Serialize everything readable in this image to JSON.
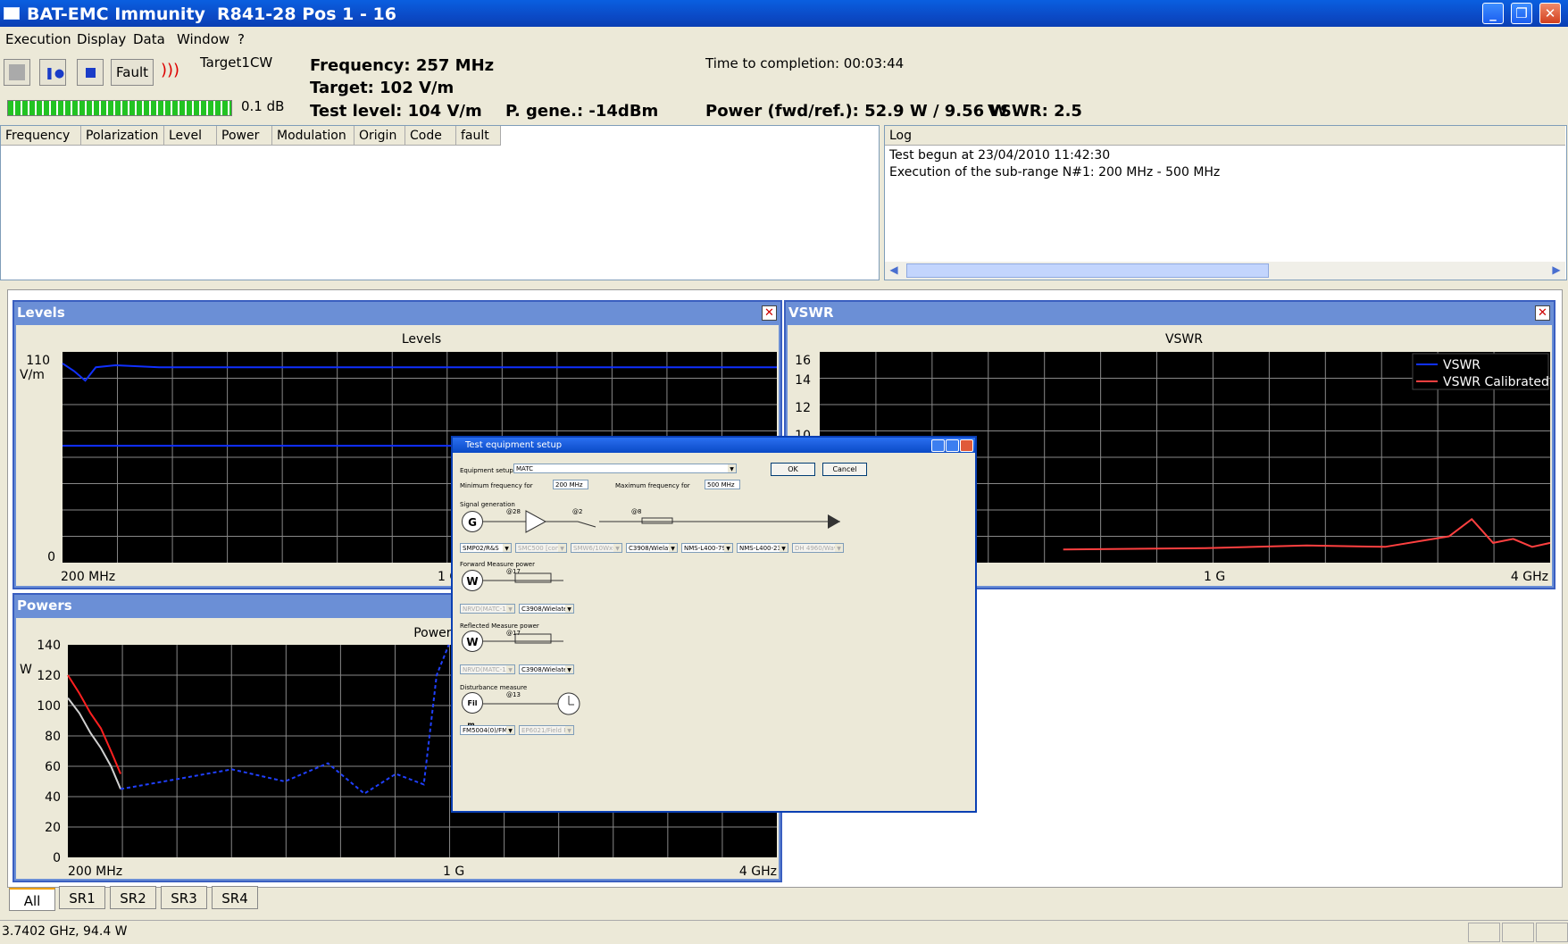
{
  "window": {
    "app_name": "BAT-EMC  Immunity",
    "document": "R841-28 Pos 1 - 16"
  },
  "menu": [
    "Execution",
    "Display",
    "Data",
    "Window",
    "?"
  ],
  "toolbar": {
    "fault_label": "Fault",
    "target_name": "Target1CW",
    "progress_fraction": 1.0,
    "attenuation": "0.1 dB"
  },
  "status": {
    "frequency": "Frequency: 257 MHz",
    "target": "Target: 102 V/m",
    "test_level": "Test level: 104 V/m",
    "p_gene": "P. gene.: -14dBm",
    "time_to_completion": "Time to completion: 00:03:44",
    "power": "Power (fwd/ref.): 52.9 W / 9.56 W",
    "vswr": "VSWR: 2.5"
  },
  "fault_table": {
    "columns": [
      "Frequency",
      "Polarization",
      "Level",
      "Power",
      "Modulation",
      "Origin",
      "Code",
      "fault"
    ],
    "rows": []
  },
  "log": {
    "title": "Log",
    "lines": [
      "Test begun at 23/04/2010 11:42:30",
      "Execution of the sub-range N#1: 200 MHz - 500 MHz"
    ]
  },
  "panels": {
    "levels": {
      "window_title": "Levels",
      "chart_title": "Levels",
      "y_top": "110",
      "y_unit": "V/m",
      "y_bottom": "0",
      "x_ticks": [
        "200 MHz",
        "1 G"
      ]
    },
    "vswr": {
      "window_title": "VSWR",
      "chart_title": "VSWR",
      "y_ticks": [
        "16",
        "14",
        "12",
        "10"
      ],
      "x_ticks": [
        "1 G",
        "4 GHz"
      ],
      "legend": [
        "VSWR",
        "VSWR Calibrated"
      ]
    },
    "powers": {
      "window_title": "Powers",
      "chart_title": "Powers",
      "y_unit": "W",
      "y_ticks": [
        "140",
        "120",
        "100",
        "80",
        "60",
        "40",
        "20",
        "0"
      ],
      "x_ticks": [
        "200 MHz",
        "1 G",
        "4 GHz"
      ]
    }
  },
  "chart_data": [
    {
      "type": "line",
      "title": "Levels",
      "ylabel": "V/m",
      "ylim": [
        0,
        110
      ],
      "x_scale": "log",
      "xlim_text": [
        "200 MHz",
        "4 GHz"
      ],
      "series": [
        {
          "name": "",
          "color": "#1030ff",
          "x": [
            0.2,
            0.21,
            0.22,
            0.23,
            0.25,
            0.3,
            0.5,
            1,
            2,
            4
          ],
          "y": [
            104,
            100,
            95,
            102,
            103,
            102,
            102,
            102,
            102,
            102
          ]
        },
        {
          "name": "",
          "color": "#1030ff",
          "x": [
            0.2,
            4
          ],
          "y": [
            61,
            61
          ]
        }
      ]
    },
    {
      "type": "line",
      "title": "VSWR",
      "ylim": [
        0,
        16
      ],
      "x_scale": "log",
      "series": [
        {
          "name": "VSWR",
          "color": "#1030ff",
          "x": [],
          "y": []
        },
        {
          "name": "VSWR Calibrated",
          "color": "#ff4040",
          "x": [
            1,
            1.5,
            2,
            2.5,
            3,
            3.2,
            3.4,
            3.6,
            3.8,
            4
          ],
          "y": [
            1.0,
            1.1,
            1.3,
            1.2,
            2.0,
            3.3,
            1.5,
            1.8,
            1.2,
            1.5
          ]
        }
      ]
    },
    {
      "type": "line",
      "title": "Powers",
      "ylabel": "W",
      "ylim": [
        0,
        140
      ],
      "x_scale": "log",
      "series": [
        {
          "name": "",
          "color": "#ff2020",
          "x": [
            0.2,
            0.21,
            0.22,
            0.23,
            0.24,
            0.25
          ],
          "y": [
            120,
            108,
            95,
            85,
            70,
            55
          ]
        },
        {
          "name": "",
          "color": "#d0d0d0",
          "x": [
            0.2,
            0.21,
            0.22,
            0.23,
            0.24,
            0.25
          ],
          "y": [
            105,
            95,
            82,
            72,
            60,
            45
          ]
        },
        {
          "name": "",
          "color": "#2040ff",
          "x": [
            0.25,
            0.3,
            0.4,
            0.5,
            0.6,
            0.7,
            0.8,
            0.9,
            0.95,
            1.0
          ],
          "y": [
            45,
            50,
            58,
            50,
            62,
            42,
            55,
            48,
            120,
            140
          ]
        }
      ]
    }
  ],
  "dialog": {
    "title": "Test equipment setup",
    "equipment_setup_label": "Equipment setup",
    "equipment_setup_value": "MATC",
    "ok": "OK",
    "cancel": "Cancel",
    "min_freq_label": "Minimum frequency for",
    "min_freq": "200 MHz",
    "max_freq_label": "Maximum frequency for",
    "max_freq": "500 MHz",
    "signal_generation": "Signal generation",
    "gen_addr": "@28",
    "amp_addr": "@2",
    "sw_addr": "@8",
    "gen_selects": [
      "SMP02/R&S",
      "SMC500 [cond]",
      "SMW6/10Wx62",
      "C3908/Wielatec",
      "NMS-L400-79.0",
      "NMS-L400-237",
      "DH 4960/Wavin"
    ],
    "forward_power": "Forward Measure power",
    "fwd_addr": "@17",
    "fwd_selects": [
      "NRVD(MATC-1)",
      "C3908/Wielatec"
    ],
    "reflected_power": "Reflected Measure power",
    "ref_addr": "@17",
    "ref_selects": [
      "NRVD(MATC-1)",
      "C3908/Wielatec"
    ],
    "disturbance": "Disturbance measure",
    "dist_addr": "@13",
    "dist_selects": [
      "FM5004(0)/FMT",
      "EP6021/Field Pr"
    ],
    "G": "G",
    "W": "W",
    "Fil": "Fil m."
  },
  "bottom_tabs": [
    "All",
    "SR1",
    "SR2",
    "SR3",
    "SR4"
  ],
  "statusbar": "3.7402 GHz, 94.4 W"
}
